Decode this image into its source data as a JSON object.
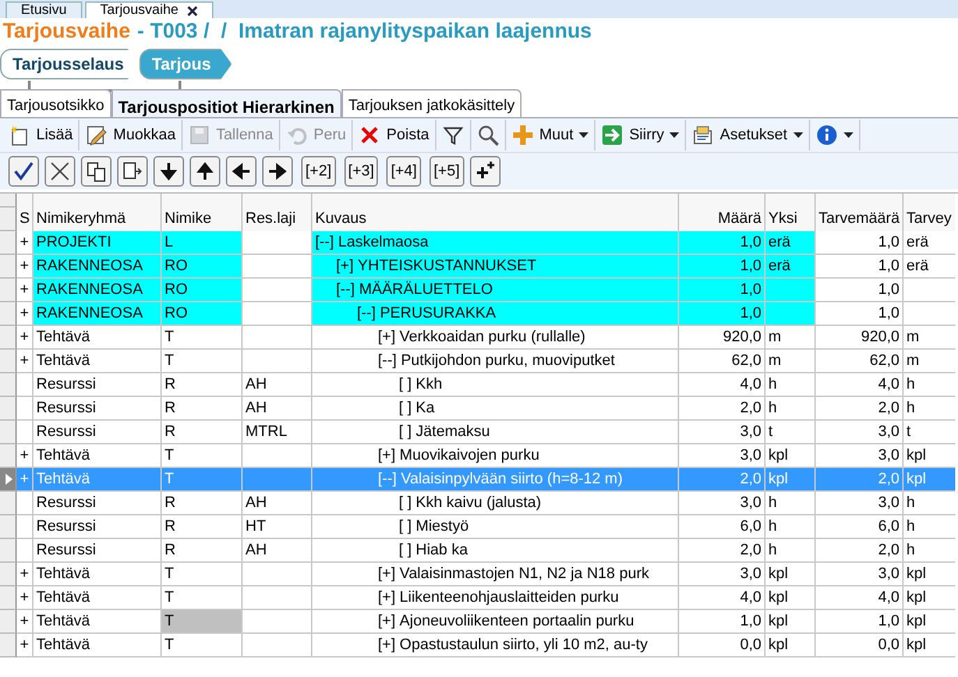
{
  "top_tabs": [
    {
      "label": "Etusivu",
      "selected": false,
      "closable": false
    },
    {
      "label": "Tarjousvaihe",
      "selected": true,
      "closable": true
    }
  ],
  "title": {
    "module": "Tarjousvaihe",
    "text": "- T003 /  /  Imatran rajanylityspaikan laajennus"
  },
  "breadcrumb": [
    {
      "label": "Tarjousselaus",
      "selected": false
    },
    {
      "label": "Tarjous",
      "selected": true
    }
  ],
  "tabs": [
    {
      "label": "Tarjousotsikko",
      "selected": false
    },
    {
      "label": "Tarjouspositiot Hierarkinen",
      "selected": true
    },
    {
      "label": "Tarjouksen jatkokäsittely",
      "selected": false
    }
  ],
  "toolbar": [
    {
      "kind": "button",
      "label": "Lisää",
      "disabled": false,
      "dropdown": false
    },
    {
      "kind": "button",
      "label": "Muokkaa",
      "disabled": false,
      "dropdown": false
    },
    {
      "kind": "button",
      "label": "Tallenna",
      "disabled": true,
      "dropdown": false
    },
    {
      "kind": "button",
      "label": "Peru",
      "disabled": true,
      "dropdown": false
    },
    {
      "kind": "button",
      "label": "Poista",
      "disabled": false,
      "dropdown": false
    },
    {
      "kind": "icon",
      "disabled": false,
      "dropdown": false
    },
    {
      "kind": "icon",
      "disabled": false,
      "dropdown": false
    },
    {
      "kind": "button",
      "label": "Muut",
      "disabled": false,
      "dropdown": true
    },
    {
      "kind": "button",
      "label": "Siirry",
      "disabled": false,
      "dropdown": true
    },
    {
      "kind": "button",
      "label": "Asetukset",
      "disabled": false,
      "dropdown": true
    },
    {
      "kind": "icon",
      "disabled": false,
      "dropdown": true
    }
  ],
  "toolbar2": [
    {
      "kind": "icon"
    },
    {
      "kind": "icon"
    },
    {
      "kind": "icon"
    },
    {
      "kind": "icon"
    },
    {
      "kind": "icon"
    },
    {
      "kind": "icon"
    },
    {
      "kind": "icon"
    },
    {
      "kind": "icon"
    },
    {
      "kind": "text",
      "label": "[+2]"
    },
    {
      "kind": "text",
      "label": "[+3]"
    },
    {
      "kind": "text",
      "label": "[+4]"
    },
    {
      "kind": "text",
      "label": "[+5]"
    },
    {
      "kind": "icon"
    }
  ],
  "table": {
    "columns": [
      "S",
      "Nimikeryhmä",
      "Nimike",
      "Res.laji",
      "Kuvaus",
      "Määrä",
      "Yksi",
      "Tarvemäärä",
      "Tarvey"
    ],
    "rows": [
      {
        "s": "+",
        "group": "PROJEKTI",
        "item": "L",
        "toggle": "[--]",
        "description": "Laskelmaosa",
        "qty": "1,0",
        "unit": "erä",
        "need": "1,0",
        "need_unit": "erä",
        "highlighted": true,
        "selected": false,
        "focused": false,
        "children": [
          {
            "s": "+",
            "group": "RAKENNEOSA",
            "item": "RO",
            "toggle": "[+]",
            "description": "YHTEISKUSTANNUKSET",
            "qty": "1,0",
            "unit": "erä",
            "need": "1,0",
            "need_unit": "erä",
            "highlighted": true,
            "selected": false,
            "focused": false
          },
          {
            "s": "+",
            "group": "RAKENNEOSA",
            "item": "RO",
            "toggle": "[--]",
            "description": "MÄÄRÄLUETTELO",
            "qty": "1,0",
            "need": "1,0",
            "highlighted": true,
            "selected": false,
            "focused": false,
            "children": [
              {
                "s": "+",
                "group": "RAKENNEOSA",
                "item": "RO",
                "toggle": "[--]",
                "description": "PERUSURAKKA",
                "qty": "1,0",
                "need": "1,0",
                "highlighted": true,
                "selected": false,
                "focused": false,
                "children": [
                  {
                    "s": "+",
                    "group": "Tehtävä",
                    "item": "T",
                    "toggle": "[+]",
                    "description": "Verkkoaidan purku (rullalle)",
                    "qty": "920,0",
                    "unit": "m",
                    "need": "920,0",
                    "need_unit": "m",
                    "highlighted": false,
                    "selected": false,
                    "focused": false
                  },
                  {
                    "s": "+",
                    "group": "Tehtävä",
                    "item": "T",
                    "toggle": "[--]",
                    "description": "Putkijohdon purku, muoviputket",
                    "qty": "62,0",
                    "unit": "m",
                    "need": "62,0",
                    "need_unit": "m",
                    "highlighted": false,
                    "selected": false,
                    "focused": false,
                    "children": [
                      {
                        "group": "Resurssi",
                        "item": "R",
                        "res": "AH",
                        "toggle": "[ ]",
                        "description": "Kkh",
                        "qty": "4,0",
                        "unit": "h",
                        "need": "4,0",
                        "need_unit": "h",
                        "highlighted": false,
                        "selected": false,
                        "focused": false
                      },
                      {
                        "group": "Resurssi",
                        "item": "R",
                        "res": "AH",
                        "toggle": "[ ]",
                        "description": "Ka",
                        "qty": "2,0",
                        "unit": "h",
                        "need": "2,0",
                        "need_unit": "h",
                        "highlighted": false,
                        "selected": false,
                        "focused": false
                      },
                      {
                        "group": "Resurssi",
                        "item": "R",
                        "res": "MTRL",
                        "toggle": "[ ]",
                        "description": "Jätemaksu",
                        "qty": "3,0",
                        "unit": "t",
                        "need": "3,0",
                        "need_unit": "t",
                        "highlighted": false,
                        "selected": false,
                        "focused": false
                      }
                    ]
                  },
                  {
                    "s": "+",
                    "group": "Tehtävä",
                    "item": "T",
                    "toggle": "[+]",
                    "description": "Muovikaivojen purku",
                    "qty": "3,0",
                    "unit": "kpl",
                    "need": "3,0",
                    "need_unit": "kpl",
                    "highlighted": false,
                    "selected": false,
                    "focused": false
                  },
                  {
                    "s": "+",
                    "group": "Tehtävä",
                    "item": "T",
                    "toggle": "[--]",
                    "description": "Valaisinpylvään siirto (h=8-12 m)",
                    "qty": "2,0",
                    "unit": "kpl",
                    "need": "2,0",
                    "need_unit": "kpl",
                    "highlighted": false,
                    "selected": true,
                    "focused": false,
                    "children": [
                      {
                        "group": "Resurssi",
                        "item": "R",
                        "res": "AH",
                        "toggle": "[ ]",
                        "description": "Kkh kaivu (jalusta)",
                        "qty": "3,0",
                        "unit": "h",
                        "need": "3,0",
                        "need_unit": "h",
                        "highlighted": false,
                        "selected": false,
                        "focused": false
                      },
                      {
                        "group": "Resurssi",
                        "item": "R",
                        "res": "HT",
                        "toggle": "[ ]",
                        "description": "Miestyö",
                        "qty": "6,0",
                        "unit": "h",
                        "need": "6,0",
                        "need_unit": "h",
                        "highlighted": false,
                        "selected": false,
                        "focused": false
                      },
                      {
                        "group": "Resurssi",
                        "item": "R",
                        "res": "AH",
                        "toggle": "[ ]",
                        "description": "Hiab ka",
                        "qty": "2,0",
                        "unit": "h",
                        "need": "2,0",
                        "need_unit": "h",
                        "highlighted": false,
                        "selected": false,
                        "focused": false
                      }
                    ]
                  },
                  {
                    "s": "+",
                    "group": "Tehtävä",
                    "item": "T",
                    "toggle": "[+]",
                    "description": "Valaisinmastojen N1, N2 ja N18 purk",
                    "qty": "3,0",
                    "unit": "kpl",
                    "need": "3,0",
                    "need_unit": "kpl",
                    "highlighted": false,
                    "selected": false,
                    "focused": false
                  },
                  {
                    "s": "+",
                    "group": "Tehtävä",
                    "item": "T",
                    "toggle": "[+]",
                    "description": "Liikenteenohjauslaitteiden purku",
                    "qty": "4,0",
                    "unit": "kpl",
                    "need": "4,0",
                    "need_unit": "kpl",
                    "highlighted": false,
                    "selected": false,
                    "focused": false
                  },
                  {
                    "s": "+",
                    "group": "Tehtävä",
                    "item": "T",
                    "toggle": "[+]",
                    "description": "Ajoneuvoliikenteen portaalin purku",
                    "qty": "1,0",
                    "unit": "kpl",
                    "need": "1,0",
                    "need_unit": "kpl",
                    "highlighted": false,
                    "selected": false,
                    "focused": true
                  },
                  {
                    "s": "+",
                    "group": "Tehtävä",
                    "item": "T",
                    "toggle": "[+]",
                    "description": "Opastustaulun siirto, yli 10 m2, au-ty",
                    "qty": "0,0",
                    "unit": "kpl",
                    "need": "0,0",
                    "need_unit": "kpl",
                    "highlighted": false,
                    "selected": false,
                    "focused": false
                  }
                ]
              }
            ]
          }
        ]
      }
    ]
  }
}
